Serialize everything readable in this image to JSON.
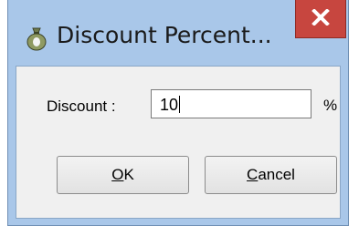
{
  "window": {
    "title": "Discount Percent...",
    "close_label": "x",
    "title_icon": "money-bag-icon",
    "close_color": "#c7463f"
  },
  "form": {
    "discount_label": "Discount :",
    "discount_value": "10",
    "unit": "%"
  },
  "buttons": {
    "ok_mnemonic": "O",
    "ok_rest": "K",
    "cancel_mnemonic": "C",
    "cancel_rest": "ancel"
  }
}
